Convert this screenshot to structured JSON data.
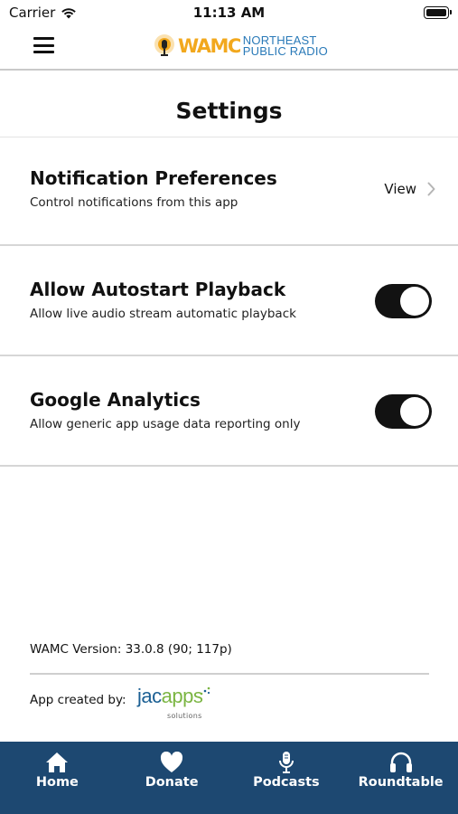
{
  "status_bar": {
    "carrier": "Carrier",
    "time": "11:13 AM"
  },
  "header": {
    "logo": {
      "wordmark": "WAMC",
      "line1": "NORTHEAST",
      "line2": "PUBLIC RADIO"
    },
    "colors": {
      "logo_gold": "#f2a81d",
      "logo_blue": "#2a7ab8"
    }
  },
  "page": {
    "title": "Settings"
  },
  "settings": [
    {
      "title": "Notification Preferences",
      "description": "Control notifications from this app",
      "action": "View"
    },
    {
      "title": "Allow Autostart Playback",
      "description": "Allow live audio stream automatic playback",
      "enabled": true
    },
    {
      "title": "Google Analytics",
      "description": "Allow generic app usage data reporting only",
      "enabled": true
    }
  ],
  "footer": {
    "version": "WAMC Version: 33.0.8 (90; 117p)",
    "created_by": "App created by:",
    "maker_logo": {
      "j": "jac",
      "rest": "apps",
      "sub": "solutions"
    }
  },
  "tabs": [
    {
      "label": "Home",
      "icon": "home-icon"
    },
    {
      "label": "Donate",
      "icon": "heart-icon"
    },
    {
      "label": "Podcasts",
      "icon": "microphone-icon"
    },
    {
      "label": "Roundtable",
      "icon": "headphones-icon"
    }
  ],
  "colors": {
    "tab_bar": "#1d4871",
    "toggle_on": "#121212"
  }
}
